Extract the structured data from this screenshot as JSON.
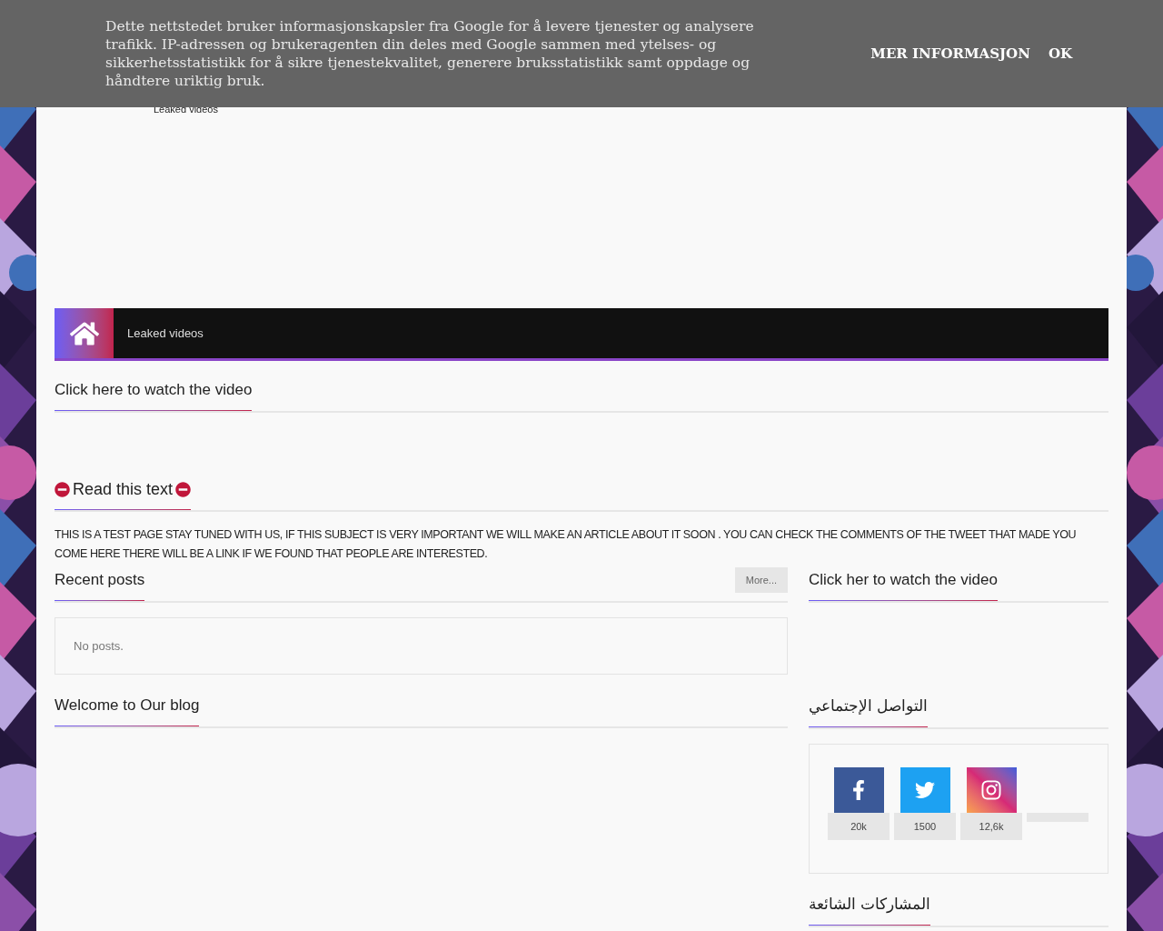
{
  "cookie_banner": {
    "message": "Dette nettstedet bruker informasjonskapsler fra Google for å levere tjenester og analysere trafikk. IP-adressen og brukeragenten din deles med Google sammen med ytelses- og sikkerhetsstatistikk for å sikre tjenestekvalitet, generere bruksstatistikk samt oppdage og håndtere uriktig bruk.",
    "buttons": [
      "MER INFORMASJON",
      "OK"
    ]
  },
  "header": {
    "tagline": "Leaked videos"
  },
  "nav": {
    "items": [
      "Leaked videos"
    ]
  },
  "sections": [
    {
      "title": "Click here to watch the video"
    },
    {
      "title": "Read this text",
      "body": "THIS IS A TEST PAGE STAY TUNED WITH US, IF THIS SUBJECT IS VERY IMPORTANT WE WILL MAKE AN ARTICLE ABOUT IT SOON . YOU CAN CHECK THE COMMENTS OF THE TWEET THAT MADE YOU COME HERE THERE WILL BE A LINK IF WE FOUND THAT PEOPLE ARE INTERESTED."
    }
  ],
  "recent_posts": {
    "title": "Recent posts",
    "more": "More...",
    "empty": "No posts."
  },
  "welcome": {
    "title": "Welcome to Our blog"
  },
  "sidebar": {
    "video_title": "Click her to watch the video",
    "social_title": "التواصل الإجتماعي",
    "social": [
      {
        "kind": "facebook",
        "count": "20k"
      },
      {
        "kind": "twitter",
        "count": "1500"
      },
      {
        "kind": "instagram",
        "count": "12,6k"
      },
      {
        "kind": "blank"
      }
    ],
    "popular_title": "المشاركات الشائعة"
  }
}
